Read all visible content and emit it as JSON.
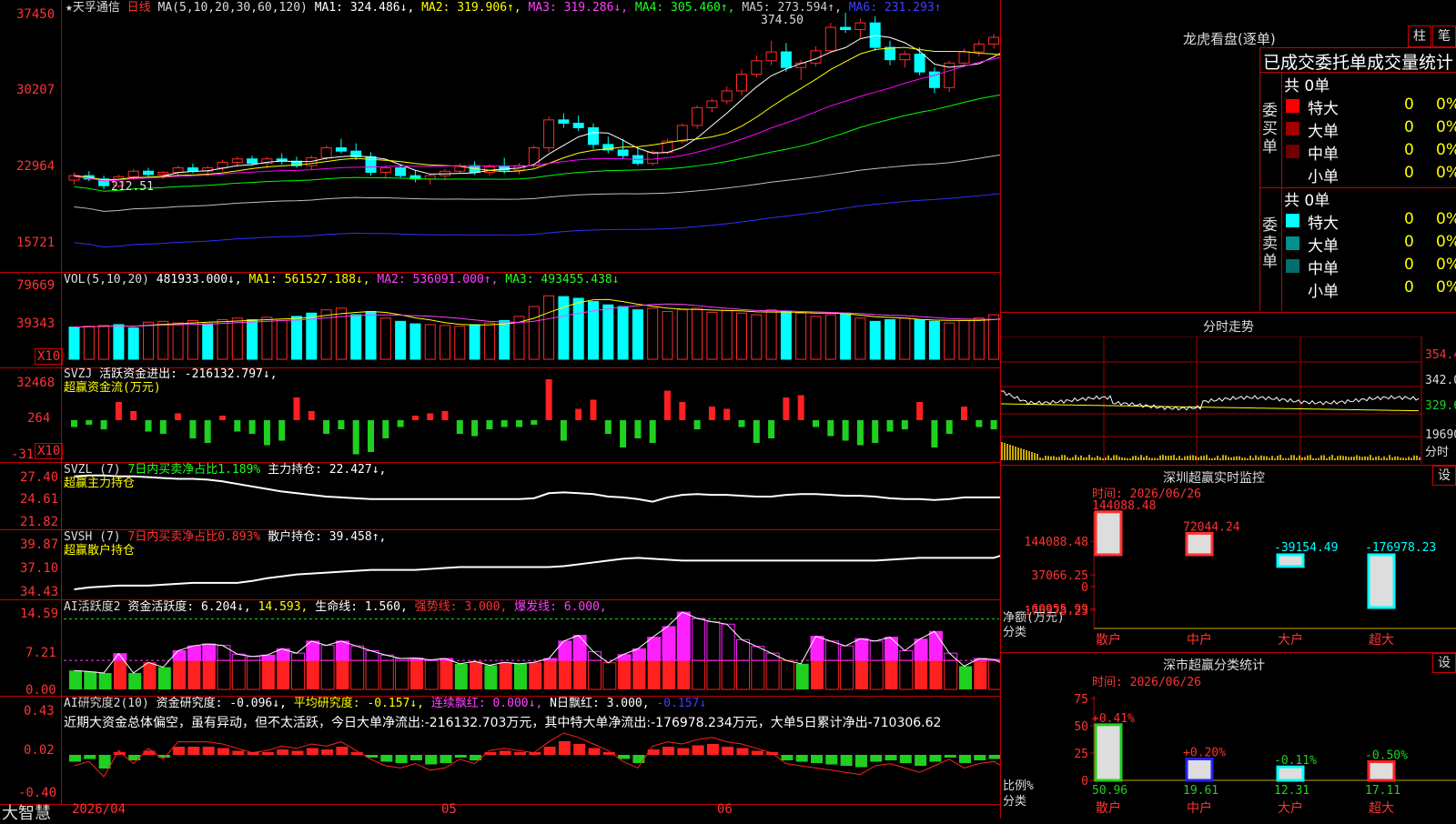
{
  "stock": {
    "name": "★天孚通信",
    "period": "日线"
  },
  "main": {
    "ma_label": "MA(5,10,20,30,60,120)",
    "ma1": "MA1: 324.486↓,",
    "ma2": "MA2: 319.906↑,",
    "ma3": "MA3: 319.286↓,",
    "ma4": "MA4: 305.460↑,",
    "ma5": "MA5: 273.594↑,",
    "ma6": "MA6: 231.293↑",
    "y_ticks": [
      "37450",
      "30207",
      "22964",
      "15721"
    ],
    "high_label": "374.50",
    "low_label": "212.51",
    "candles": [
      [
        225,
        232,
        221,
        229
      ],
      [
        229,
        233,
        224,
        226
      ],
      [
        226,
        229,
        217,
        220
      ],
      [
        220,
        230,
        218,
        228
      ],
      [
        228,
        235,
        225,
        233
      ],
      [
        233,
        236,
        228,
        230
      ],
      [
        230,
        233,
        226,
        232
      ],
      [
        232,
        238,
        229,
        236
      ],
      [
        236,
        240,
        231,
        233
      ],
      [
        233,
        238,
        228,
        236
      ],
      [
        236,
        243,
        233,
        241
      ],
      [
        241,
        246,
        237,
        244
      ],
      [
        244,
        247,
        238,
        240
      ],
      [
        240,
        246,
        236,
        244
      ],
      [
        244,
        249,
        239,
        242
      ],
      [
        242,
        246,
        236,
        238
      ],
      [
        238,
        247,
        234,
        245
      ],
      [
        245,
        256,
        243,
        254
      ],
      [
        254,
        262,
        249,
        251
      ],
      [
        251,
        258,
        243,
        246
      ],
      [
        246,
        250,
        229,
        232
      ],
      [
        232,
        238,
        227,
        236
      ],
      [
        236,
        239,
        227,
        229
      ],
      [
        229,
        234,
        223,
        226
      ],
      [
        226,
        231,
        221,
        229
      ],
      [
        229,
        235,
        225,
        233
      ],
      [
        233,
        240,
        231,
        238
      ],
      [
        238,
        242,
        230,
        232
      ],
      [
        232,
        239,
        229,
        237
      ],
      [
        237,
        245,
        231,
        234
      ],
      [
        234,
        240,
        230,
        238
      ],
      [
        238,
        256,
        236,
        254
      ],
      [
        254,
        282,
        250,
        279
      ],
      [
        279,
        285,
        272,
        276
      ],
      [
        276,
        283,
        269,
        272
      ],
      [
        272,
        276,
        253,
        257
      ],
      [
        257,
        264,
        249,
        252
      ],
      [
        252,
        262,
        244,
        247
      ],
      [
        247,
        255,
        238,
        240
      ],
      [
        240,
        252,
        238,
        250
      ],
      [
        250,
        262,
        248,
        260
      ],
      [
        260,
        276,
        258,
        274
      ],
      [
        274,
        292,
        271,
        290
      ],
      [
        290,
        298,
        286,
        296
      ],
      [
        296,
        309,
        293,
        305
      ],
      [
        305,
        324,
        301,
        320
      ],
      [
        320,
        337,
        317,
        332
      ],
      [
        332,
        350,
        328,
        340
      ],
      [
        340,
        348,
        322,
        326
      ],
      [
        326,
        333,
        315,
        330
      ],
      [
        330,
        345,
        327,
        341
      ],
      [
        341,
        366,
        339,
        362
      ],
      [
        362,
        375,
        357,
        360
      ],
      [
        360,
        370,
        352,
        366
      ],
      [
        366,
        372,
        341,
        344
      ],
      [
        344,
        350,
        328,
        333
      ],
      [
        333,
        341,
        326,
        338
      ],
      [
        338,
        344,
        319,
        322
      ],
      [
        322,
        326,
        303,
        308
      ],
      [
        308,
        332,
        304,
        330
      ],
      [
        330,
        343,
        327,
        340
      ],
      [
        340,
        350,
        336,
        347
      ],
      [
        347,
        356,
        343,
        353
      ],
      [
        353,
        358,
        342,
        345
      ],
      [
        345,
        352,
        333,
        336
      ],
      [
        336,
        346,
        331,
        344
      ],
      [
        344,
        358,
        339,
        347
      ],
      [
        347,
        354,
        337,
        340
      ]
    ],
    "ma_colors": {
      "ma1": "#ffffff",
      "ma2": "#ffff00",
      "ma3": "#ff00ff",
      "ma4": "#00ff00",
      "ma5": "#c0c0c0",
      "ma6": "#3030ff"
    }
  },
  "vol": {
    "label": "VOL(5,10,20)",
    "value": "481933.000↓,",
    "ma1": "MA1: 561527.188↓,",
    "ma2": "MA2: 536091.000↑,",
    "ma3": "MA3: 493455.438↓",
    "y_ticks": [
      "79669",
      "39343"
    ],
    "unit": "X10",
    "values": [
      390,
      400,
      410,
      420,
      380,
      450,
      460,
      440,
      470,
      430,
      480,
      500,
      480,
      510,
      470,
      520,
      560,
      600,
      620,
      540,
      580,
      500,
      460,
      430,
      420,
      410,
      400,
      420,
      440,
      470,
      520,
      640,
      770,
      760,
      740,
      700,
      660,
      640,
      600,
      620,
      580,
      600,
      620,
      570,
      590,
      560,
      540,
      600,
      580,
      560,
      520,
      540,
      560,
      500,
      460,
      480,
      500,
      480,
      460,
      440,
      470,
      500,
      540,
      520,
      560,
      700,
      560,
      830,
      700
    ],
    "ups": [
      0,
      1,
      1,
      0,
      0,
      1,
      1,
      1,
      1,
      0,
      1,
      1,
      0,
      1,
      1,
      0,
      0,
      1,
      1,
      0,
      0,
      1,
      0,
      0,
      1,
      1,
      1,
      0,
      1,
      0,
      1,
      1,
      1,
      0,
      0,
      0,
      0,
      0,
      0,
      1,
      1,
      1,
      1,
      1,
      1,
      1,
      1,
      1,
      0,
      1,
      1,
      1,
      0,
      1,
      0,
      0,
      1,
      0,
      0,
      1,
      1,
      1,
      1,
      0,
      0,
      1,
      1,
      0,
      0
    ]
  },
  "svzj": {
    "label": "SVZJ",
    "desc": "活跃资金进出: -216132.797↓,",
    "sub": "超赢资金流(万元)",
    "y_ticks": [
      "32468",
      "264",
      "-31"
    ],
    "unit": "X10",
    "values": [
      -3,
      -2,
      -4,
      8,
      4,
      -5,
      -6,
      3,
      -8,
      -10,
      2,
      -5,
      -6,
      -11,
      -9,
      10,
      4,
      -6,
      -4,
      -15,
      -14,
      -8,
      -3,
      2,
      3,
      4,
      -6,
      -7,
      -4,
      -3,
      -3,
      -2,
      18,
      -9,
      5,
      9,
      -6,
      -12,
      -8,
      -10,
      13,
      8,
      -4,
      6,
      5,
      -3,
      -10,
      -8,
      10,
      11,
      -3,
      -7,
      -9,
      -11,
      -10,
      -5,
      -4,
      8,
      -12,
      -6,
      6,
      -3,
      -4,
      -5,
      -14,
      -11,
      6,
      -13
    ],
    "colors": {
      "up": "#ff2020",
      "down": "#20d020"
    }
  },
  "svzl": {
    "label": "SVZL (7)",
    "desc1": "7日内买卖净占比1.189%",
    "desc2": "主力持仓: 22.427↓,",
    "sub": "超赢主力持仓",
    "y_ticks": [
      "27.40",
      "24.61",
      "21.82"
    ],
    "values": [
      27.0,
      27.1,
      27.1,
      27.0,
      27.0,
      26.9,
      26.8,
      26.7,
      26.7,
      26.6,
      26.4,
      26.1,
      25.8,
      25.5,
      25.2,
      25.0,
      24.8,
      24.6,
      24.5,
      24.4,
      24.3,
      24.3,
      24.3,
      24.3,
      24.3,
      24.3,
      24.3,
      24.3,
      24.3,
      24.3,
      24.3,
      24.4,
      25.0,
      25.1,
      25.0,
      24.9,
      24.6,
      24.5,
      24.3,
      24.0,
      24.5,
      24.8,
      24.9,
      24.8,
      24.8,
      24.7,
      24.6,
      24.6,
      24.8,
      24.9,
      24.9,
      24.8,
      24.7,
      24.7,
      24.6,
      24.4,
      24.3,
      24.3,
      24.2,
      24.3,
      24.5,
      24.5,
      24.5,
      24.5,
      23.4,
      22.8,
      23.1,
      22.4
    ]
  },
  "svsh": {
    "label": "SVSH (7)",
    "desc1": "7日内买卖净占比0.893%",
    "desc2": "散户持仓: 39.458↑,",
    "sub": "超赢散户持仓",
    "y_ticks": [
      "39.87",
      "37.10",
      "34.43"
    ],
    "values": [
      34.6,
      34.8,
      34.9,
      35.0,
      35.0,
      35.0,
      35.1,
      35.2,
      35.3,
      35.3,
      35.3,
      35.3,
      35.5,
      35.8,
      36.0,
      36.2,
      36.3,
      36.4,
      36.5,
      36.6,
      36.7,
      36.7,
      36.7,
      36.7,
      36.8,
      36.9,
      37.0,
      37.0,
      37.0,
      37.0,
      37.0,
      37.0,
      37.0,
      37.1,
      37.3,
      37.5,
      37.7,
      37.9,
      38.0,
      37.9,
      37.8,
      37.7,
      37.7,
      37.7,
      37.7,
      37.7,
      37.7,
      37.7,
      37.7,
      37.7,
      37.7,
      37.7,
      37.7,
      37.7,
      37.7,
      37.8,
      37.9,
      38.0,
      38.0,
      38.0,
      38.0,
      38.0,
      38.0,
      38.5,
      39.0,
      39.1,
      39.2,
      39.5
    ]
  },
  "ai_active": {
    "label": "AI活跃度2",
    "desc": "资金活跃度: 6.204↓,",
    "v2": "14.593,",
    "life": "生命线: 1.560,",
    "strong": "强势线: 3.000,",
    "burst": "爆发线: 6.000,",
    "y_ticks": [
      "14.59",
      "7.21",
      "0.00"
    ],
    "values": [
      3.9,
      3.7,
      3.4,
      7.4,
      3.4,
      5.6,
      4.6,
      8.0,
      9.0,
      9.4,
      9.1,
      7.3,
      6.8,
      7.1,
      8.4,
      7.5,
      10.0,
      9.1,
      10.0,
      9.0,
      8.0,
      7.1,
      6.4,
      6.5,
      6.1,
      6.4,
      5.3,
      5.8,
      5.0,
      5.6,
      5.3,
      5.6,
      6.4,
      10.0,
      11.2,
      7.8,
      5.5,
      7.2,
      8.4,
      10.8,
      13.0,
      16.0,
      14.7,
      14.0,
      13.5,
      10.3,
      8.9,
      7.5,
      6.0,
      5.3,
      11.0,
      10.0,
      9.0,
      10.5,
      10.0,
      10.8,
      8.0,
      10.4,
      12.0,
      7.5,
      4.8,
      6.4,
      6.2,
      4.8,
      5.4,
      5.0,
      7.0,
      7.0,
      10.0,
      5.0,
      5.4,
      12.4,
      7.0
    ],
    "colors": {
      "red": "#ff2020",
      "magenta": "#ff20ff",
      "green": "#20d020"
    }
  },
  "ai_research": {
    "label": "AI研究度2(10)",
    "desc": "资金研究度: -0.096↓,",
    "avg": "平均研究度: -0.157↓,",
    "red": "连续飘红: 0.000↓,",
    "nday": "N日飘红: 3.000,",
    "extra": "-0.157↓",
    "text": "近期大资金总体偏空，虽有异动，但不太活跃，今日大单净流出:-216132.703万元，其中特大单净流出:-176978.234万元，大单5日累计净出-710306.62",
    "y_ticks": [
      "0.43",
      "0.02",
      "-0.40"
    ],
    "values": [
      -0.05,
      -0.03,
      -0.1,
      0.02,
      -0.04,
      0.03,
      -0.02,
      0.06,
      0.06,
      0.06,
      0.05,
      0.03,
      0.01,
      0.02,
      0.04,
      0.03,
      0.05,
      0.04,
      0.06,
      0.02,
      -0.02,
      -0.05,
      -0.06,
      -0.04,
      -0.07,
      -0.06,
      -0.02,
      -0.04,
      0.02,
      0.03,
      0.02,
      0.01,
      0.06,
      0.1,
      0.08,
      0.05,
      0.02,
      -0.03,
      -0.06,
      0.04,
      0.06,
      0.05,
      0.07,
      0.08,
      0.06,
      0.05,
      0.03,
      0.01,
      -0.04,
      -0.05,
      -0.06,
      -0.07,
      -0.08,
      -0.09,
      -0.05,
      -0.04,
      -0.06,
      -0.08,
      -0.05,
      -0.02,
      -0.06,
      -0.04,
      -0.03,
      -0.07,
      -0.05,
      -0.09,
      0.01,
      -0.06
    ]
  },
  "xaxis": {
    "d1": "2026/04",
    "d2": "05",
    "d3": "06",
    "logo": "大智慧"
  },
  "right": {
    "lhb_title": "龙虎看盘(逐单)",
    "btn1": "柱",
    "btn2": "笔",
    "order_title": "已成交委托单成交量统计",
    "buy_side": "委买单",
    "sell_side": "委卖单",
    "buy_total": "共 0单",
    "sell_total": "共 0单",
    "buy_rows": [
      {
        "label": "特大",
        "n": "0",
        "p": "0%",
        "color": "#ff0000"
      },
      {
        "label": "大单",
        "n": "0",
        "p": "0%",
        "color": "#a00000"
      },
      {
        "label": "中单",
        "n": "0",
        "p": "0%",
        "color": "#700000"
      },
      {
        "label": "小单",
        "n": "0",
        "p": "0%",
        "color": ""
      }
    ],
    "sell_rows": [
      {
        "label": "特大",
        "n": "0",
        "p": "0%",
        "color": "#00ffff"
      },
      {
        "label": "大单",
        "n": "0",
        "p": "0%",
        "color": "#009090"
      },
      {
        "label": "中单",
        "n": "0",
        "p": "0%",
        "color": "#006e6e"
      },
      {
        "label": "小单",
        "n": "0",
        "p": "0%",
        "color": ""
      }
    ],
    "intraday_title": "分时走势",
    "intraday_ticks": [
      "354.4",
      "342.0",
      "329.6",
      "19690",
      "分时"
    ],
    "sz_title": "深圳超赢实时监控",
    "set": "设",
    "sz_time": "时间: 2026/06/26",
    "sz_ticks": [
      "144088.48",
      "37066.25",
      "0",
      "-69955.99",
      "-176978.23"
    ],
    "sz_values": [
      {
        "v": 144088.48,
        "label": "144088.48"
      },
      {
        "v": 72044.24,
        "label": "72044.24"
      },
      {
        "v": -39154.49,
        "label": "-39154.49"
      },
      {
        "v": -176978.23,
        "label": "-176978.23"
      }
    ],
    "sz_unit": "净额(万元)",
    "sz_cat": "分类",
    "cats": [
      "散户",
      "中户",
      "大户",
      "超大"
    ],
    "cls_title": "深市超赢分类统计",
    "cls_time": "时间: 2026/06/26",
    "cls_ticks": [
      "75",
      "50",
      "25",
      "0"
    ],
    "cls_values": [
      {
        "v": 50.96,
        "chg": "+0.41%"
      },
      {
        "v": 19.61,
        "chg": "+0.20%"
      },
      {
        "v": 12.31,
        "chg": "-0.11%"
      },
      {
        "v": 17.11,
        "chg": "-0.50%"
      }
    ],
    "cls_unit": "比例%",
    "cls_cat": "分类"
  }
}
